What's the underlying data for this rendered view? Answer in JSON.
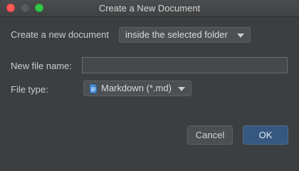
{
  "window": {
    "title": "Create a New Document"
  },
  "location": {
    "label": "Create a new document",
    "selected": "inside the selected folder"
  },
  "file_name": {
    "label": "New file name:",
    "value": ""
  },
  "file_type": {
    "label": "File type:",
    "selected": "Markdown (*.md)",
    "icon": "markdown-file-icon"
  },
  "buttons": {
    "cancel": "Cancel",
    "ok": "OK"
  },
  "colors": {
    "background": "#3c3f41",
    "ok_button": "#365880",
    "close": "#fc5b57",
    "maximize": "#33c748"
  }
}
